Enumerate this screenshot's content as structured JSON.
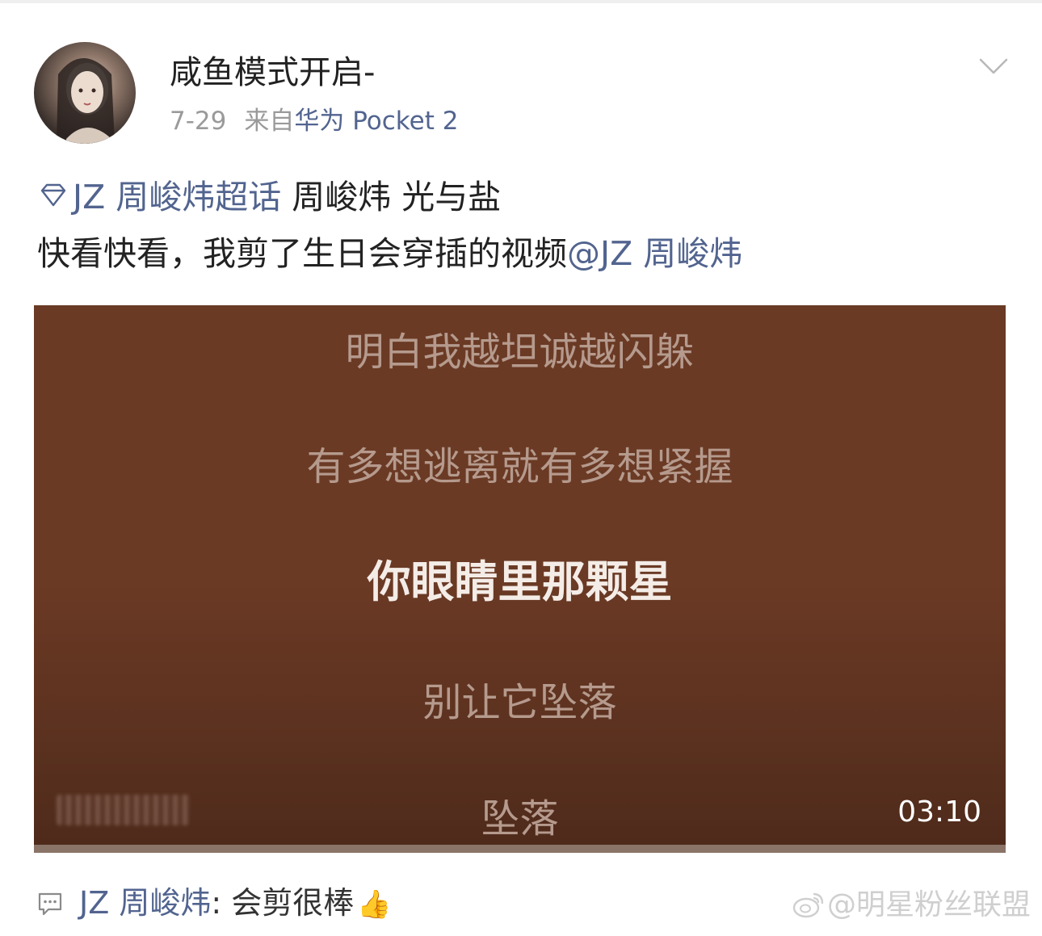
{
  "post": {
    "username": "咸鱼模式开启-",
    "date": "7-29",
    "from_label": "来自",
    "device": "华为 Pocket 2",
    "topic": "JZ 周峻炜超话",
    "tags_text": " 周峻炜 光与盐",
    "body_text": "快看快看，我剪了生日会穿插的视频",
    "mention": "@JZ 周峻炜"
  },
  "video": {
    "lyrics": [
      "明白我越坦诚越闪躲",
      "有多想逃离就有多想紧握",
      "你眼睛里那颗星",
      "别让它坠落",
      "坠落"
    ],
    "active_lyric_index": 2,
    "duration": "03:10"
  },
  "comment": {
    "author": "JZ 周峻炜",
    "separator": ": ",
    "text": "会剪很棒",
    "emoji": "👍"
  },
  "watermark": {
    "text": "@明星粉丝联盟"
  },
  "icons": {
    "more": "chevron-down-icon",
    "topic": "diamond-icon",
    "comment": "comment-bubble-icon",
    "thumb": "thumbs-up-icon",
    "brand": "weibo-icon"
  },
  "colors": {
    "link": "#52648f",
    "video_bg": "#6a3a25"
  }
}
